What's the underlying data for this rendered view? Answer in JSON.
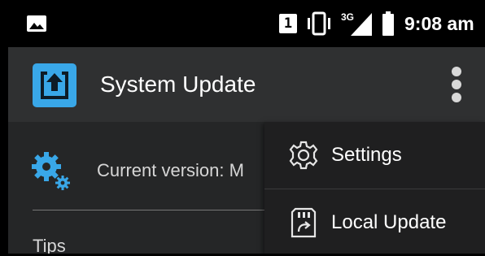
{
  "status_bar": {
    "sim_indicator": "1",
    "network_type": "3G",
    "time": "9:08 am",
    "icons": [
      "gallery-icon",
      "sim-icon",
      "vibrate-icon",
      "signal-icon",
      "battery-icon"
    ]
  },
  "app_bar": {
    "title": "System Update",
    "logo_icon": "upload-box-icon",
    "overflow_icon": "more-vert-icon"
  },
  "main": {
    "current_version_label": "Current version: M",
    "tips_label": "Tips"
  },
  "overflow_menu": {
    "items": [
      {
        "label": "Settings",
        "icon": "gear-outline-icon"
      },
      {
        "label": "Local Update",
        "icon": "sd-card-icon"
      }
    ]
  },
  "colors": {
    "status_bar_bg": "#000000",
    "app_bar_bg": "#2f3031",
    "content_bg": "#252627",
    "menu_bg": "#1f1f20",
    "accent_blue": "#39a7e8"
  }
}
